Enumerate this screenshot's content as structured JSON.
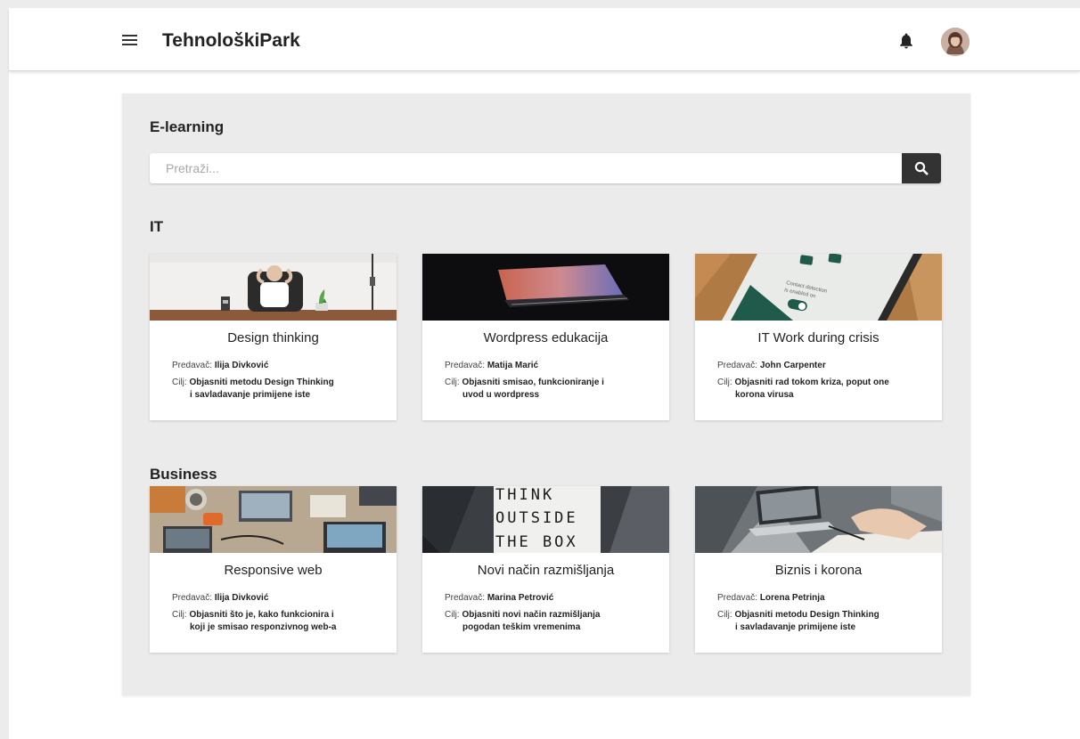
{
  "app": {
    "title": "TehnološkiPark"
  },
  "header": {
    "menu_icon": "hamburger-menu-icon",
    "bell_icon": "bell-icon"
  },
  "page": {
    "title": "E-learning",
    "search": {
      "placeholder": "Pretraži...",
      "value": ""
    }
  },
  "labels": {
    "lecturer": "Predavač:",
    "goal": "Cilj:"
  },
  "sections": [
    {
      "title": "IT",
      "courses": [
        {
          "title": "Design thinking",
          "lecturer": "Ilija Divković",
          "goal_line1": "Objasniti metodu Design Thinking",
          "goal_line2": "i savladavanje primijene iste"
        },
        {
          "title": "Wordpress edukacija",
          "lecturer": "Matija Marić",
          "goal_line1": "Objasniti smisao, funkcioniranje i",
          "goal_line2": "uvod u wordpress"
        },
        {
          "title": "IT Work during crisis",
          "lecturer": "John Carpenter",
          "goal_line1": "Objasniti rad tokom kriza, poput one",
          "goal_line2": "korona virusa"
        }
      ]
    },
    {
      "title": "Business",
      "courses": [
        {
          "title": "Responsive web",
          "lecturer": "Ilija Divković",
          "goal_line1": "Objasniti što je, kako funkcionira i",
          "goal_line2": "koji je smisao responzivnog web-a"
        },
        {
          "title": "Novi način razmišljanja",
          "lecturer": "Marina Petrović",
          "goal_line1": "Objasniti novi način razmišljanja",
          "goal_line2": "pogodan teškim vremenima"
        },
        {
          "title": "Biznis i korona",
          "lecturer": "Lorena Petrinja",
          "goal_line1": "Objasniti metodu Design Thinking",
          "goal_line2": "i savladavanje primijene iste"
        }
      ]
    }
  ],
  "image_text": {
    "contact_line1": "Contact detection",
    "contact_line2": "is enabled on",
    "think_line1": "THINK",
    "think_line2": "OUTSIDE",
    "think_line3": "THE BOX"
  },
  "colors": {
    "dark": "#333333",
    "panel": "#ebebeb",
    "card": "#ffffff"
  }
}
